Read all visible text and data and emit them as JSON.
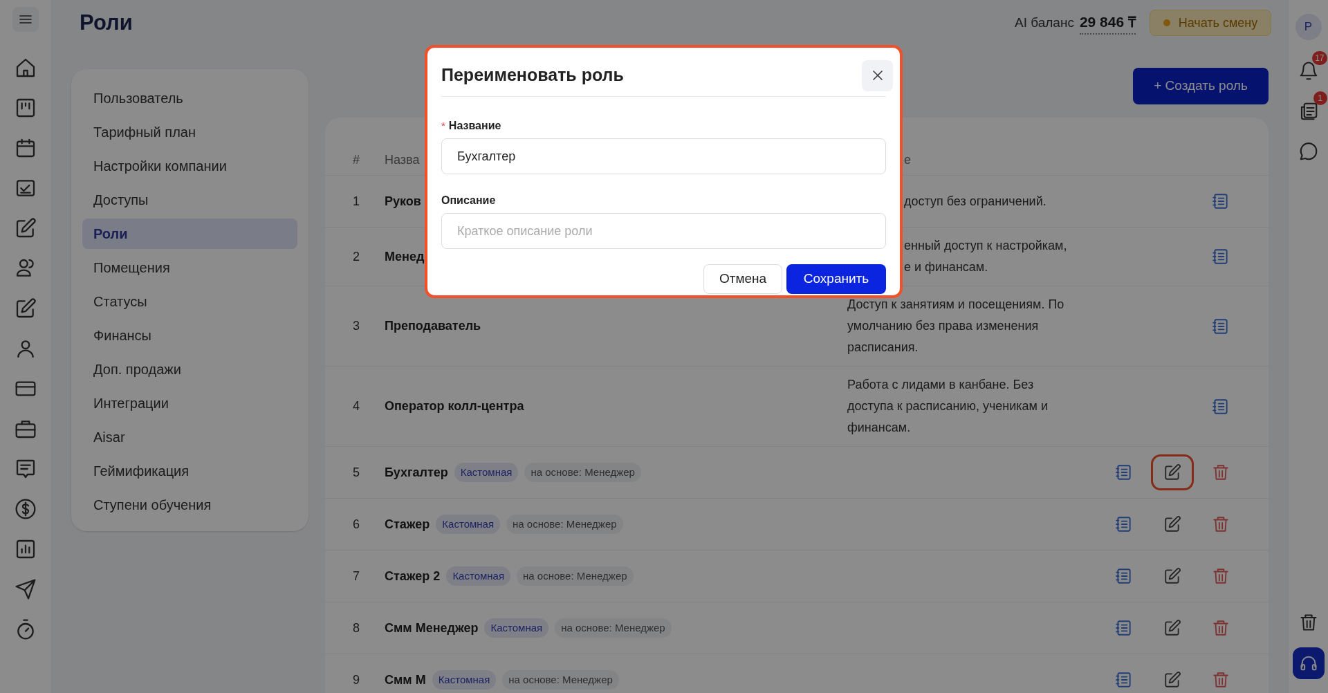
{
  "page": {
    "title": "Роли"
  },
  "top_bar": {
    "balance_label": "AI баланс",
    "balance_value": "29 846 ₸",
    "shift_button": "Начать смену",
    "avatar": "Р"
  },
  "notifications": [
    {
      "kind": "bell",
      "count": "17"
    },
    {
      "kind": "news",
      "count": "1"
    },
    {
      "kind": "chat"
    }
  ],
  "settings_menu": [
    {
      "label": "Пользователь",
      "selected": false
    },
    {
      "label": "Тарифный план",
      "selected": false
    },
    {
      "label": "Настройки компании",
      "selected": false
    },
    {
      "label": "Доступы",
      "selected": false
    },
    {
      "label": "Роли",
      "selected": true
    },
    {
      "label": "Помещения",
      "selected": false
    },
    {
      "label": "Статусы",
      "selected": false
    },
    {
      "label": "Финансы",
      "selected": false
    },
    {
      "label": "Доп. продажи",
      "selected": false
    },
    {
      "label": "Интеграции",
      "selected": false
    },
    {
      "label": "Aisar",
      "selected": false
    },
    {
      "label": "Геймификация",
      "selected": false
    },
    {
      "label": "Ступени обучения",
      "selected": false
    }
  ],
  "create_button": "+ Создать роль",
  "table": {
    "columns": [
      {
        "label": "#"
      },
      {
        "label": "Назва"
      },
      {
        "label": "е",
        "cut": true
      }
    ],
    "rows": [
      {
        "num": "1",
        "name": "Руков",
        "description": "доступ без ограничений.",
        "cut": true,
        "kind": "system"
      },
      {
        "num": "2",
        "name": "Менед",
        "description": "енный доступ к настройкам,\nе и финансам.",
        "cut": true,
        "kind": "system"
      },
      {
        "num": "3",
        "name": "Преподаватель",
        "description": "Доступ к занятиям и посещениям. По умолчанию без права изменения расписания.",
        "kind": "system"
      },
      {
        "num": "4",
        "name": "Оператор колл-центра",
        "description": "Работа с лидами в канбане. Без доступа к расписанию, ученикам и финансам.",
        "kind": "system"
      },
      {
        "num": "5",
        "name": "Бухгалтер",
        "tag": "Кастомная",
        "base": "на основе: Менеджер",
        "kind": "custom",
        "edit_highlighted": true
      },
      {
        "num": "6",
        "name": "Стажер",
        "tag": "Кастомная",
        "base": "на основе: Менеджер",
        "kind": "custom",
        "edit_highlighted": false
      },
      {
        "num": "7",
        "name": "Стажер 2",
        "tag": "Кастомная",
        "base": "на основе: Менеджер",
        "kind": "custom",
        "edit_highlighted": false
      },
      {
        "num": "8",
        "name": "Смм Менеджер",
        "tag": "Кастомная",
        "base": "на основе: Менеджер",
        "kind": "custom",
        "edit_highlighted": false
      },
      {
        "num": "9",
        "name": "Смм М",
        "tag": "Кастомная",
        "base": "на основе: Менеджер",
        "kind": "custom",
        "edit_highlighted": false
      }
    ]
  },
  "dialog": {
    "title": "Переименовать роль",
    "highlighted": true,
    "fields": [
      {
        "label": "Название",
        "marker": "*",
        "value": "Бухгалтер"
      },
      {
        "label": "Описание",
        "placeholder": "Краткое описание роли"
      }
    ],
    "buttons": [
      {
        "label": "Отмена",
        "kind": "secondary"
      },
      {
        "label": "Сохранить",
        "kind": "primary"
      }
    ]
  }
}
